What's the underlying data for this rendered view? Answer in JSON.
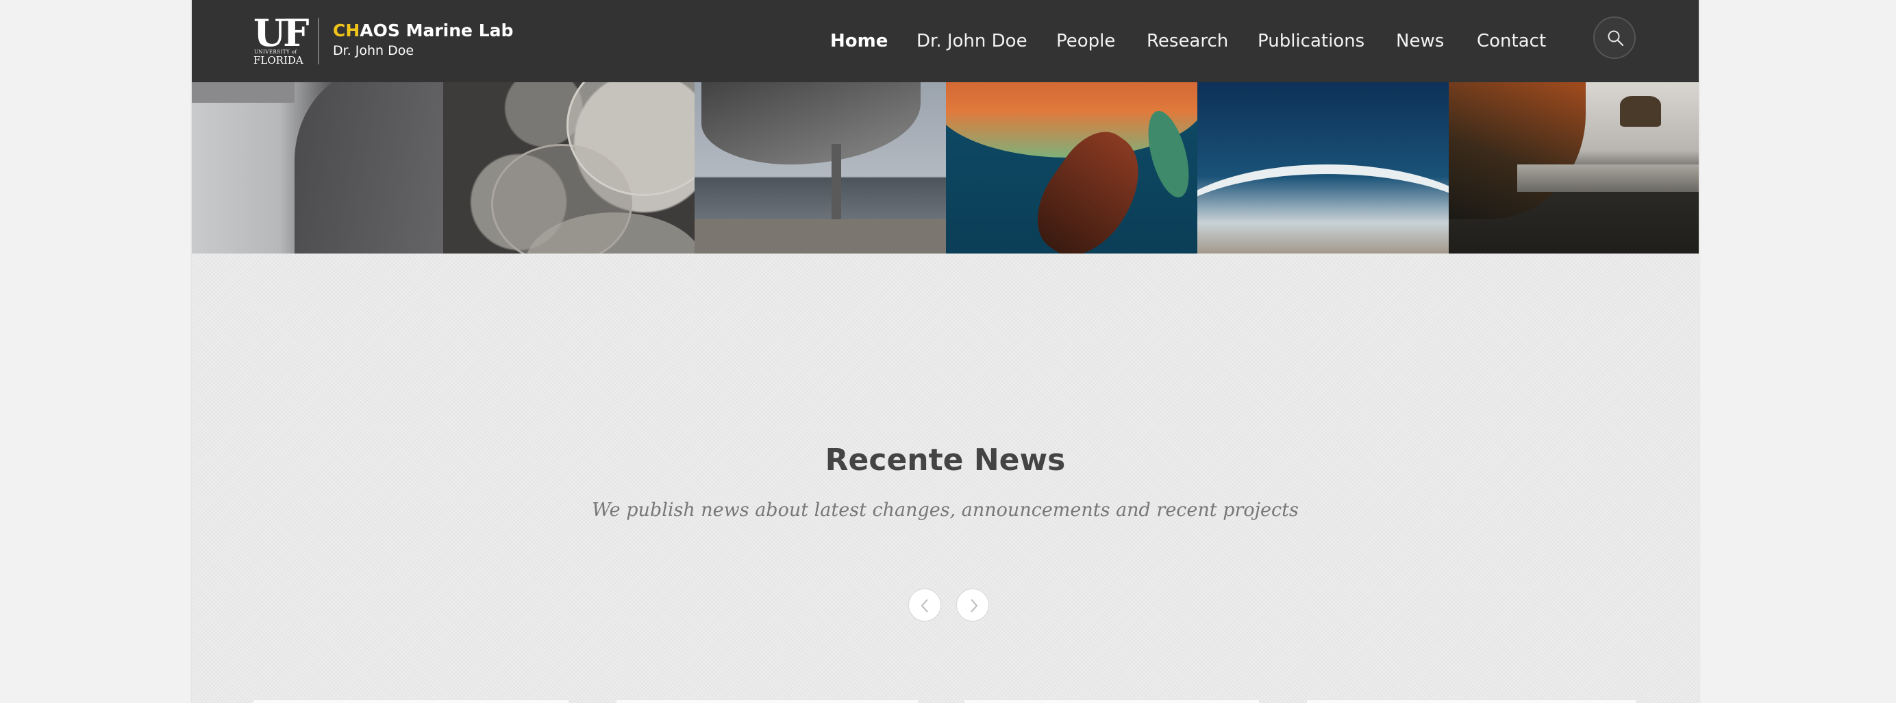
{
  "brand": {
    "uf_text": "UF",
    "uf_university": "UNIVERSITY of",
    "uf_florida": "FLORIDA",
    "lab_highlight": "CH",
    "lab_rest": "AOS Marine Lab",
    "lab_subtitle": "Dr. John Doe",
    "highlight_color": "#f0c419"
  },
  "nav": {
    "items": [
      {
        "label": "Home",
        "active": true
      },
      {
        "label": "Dr. John Doe",
        "active": false
      },
      {
        "label": "People",
        "active": false
      },
      {
        "label": "Research",
        "active": false
      },
      {
        "label": "Publications",
        "active": false
      },
      {
        "label": "News",
        "active": false
      },
      {
        "label": "Contact",
        "active": false
      }
    ],
    "search_icon": "search-icon"
  },
  "strip": {
    "images": [
      "pelican",
      "jellyfish",
      "seagull",
      "sea-turtle",
      "ocean-shore",
      "coastal-cliff"
    ]
  },
  "news": {
    "title": "Recente News",
    "subtitle": "We publish news about latest changes, announcements and recent projects",
    "prev_icon": "chevron-left-icon",
    "next_icon": "chevron-right-icon"
  },
  "colors": {
    "header_bg": "#333333",
    "page_bg": "#e9e9e9",
    "title_text": "#444444"
  }
}
